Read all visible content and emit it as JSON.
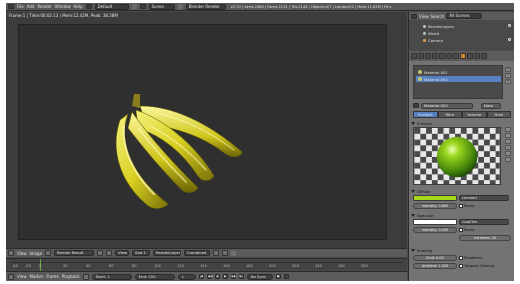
{
  "topbar": {
    "menus": [
      "File",
      "Add",
      "Render",
      "Window",
      "Help"
    ],
    "layout": "Default",
    "scene": "Scene",
    "engine": "Blender Render",
    "stats": "v2.70 | Verts:2080 | Faces:2112 | Tris:2144 | Objects:0/7 | Lamps:0/2 | Mem:11.61M | Pe:c"
  },
  "viewport": {
    "header": "Frame:1 | Time:00:02.13 | Mem:12.42M, Peak: 38.58M"
  },
  "image_header": {
    "items": [
      "View",
      "Image"
    ],
    "image_name": "Render Result",
    "view_label": "View",
    "slot": "Slot 1",
    "layer": "RenderLayer",
    "pass": "Combined"
  },
  "timeline": {
    "ticks": [
      "-40",
      "-20",
      "0",
      "20",
      "40",
      "60",
      "80",
      "100",
      "120",
      "140",
      "160",
      "180",
      "200",
      "220",
      "240",
      "260",
      "280"
    ]
  },
  "timeline_header": {
    "items": [
      "View",
      "Marker",
      "Frame",
      "Playback"
    ],
    "start": "Start: 1",
    "end": "End: 250",
    "current": "1",
    "sync": "No Sync"
  },
  "outliner": {
    "menu": "View",
    "search_label": "Search",
    "filter": "All Scenes",
    "items": [
      "RenderLayers",
      "World",
      "Camera"
    ]
  },
  "properties": {
    "materials": [
      "Material.001",
      "Material.002"
    ],
    "material_name": "Material.002",
    "data_label": "Data",
    "tabs": [
      "Surface",
      "Wire",
      "Volume",
      "Halo"
    ],
    "preview_label": "Preview",
    "diffuse": {
      "label": "Diffuse",
      "color": "#a6d619",
      "shader": "Lambert",
      "intensity": "Intensity: 0.800",
      "ramp_label": "Ramp"
    },
    "specular": {
      "label": "Specular",
      "color": "#ffffff",
      "shader": "CookTorr",
      "intensity": "Intensity: 0.500",
      "ramp_label": "Ramp",
      "hardness": "Hardness: 50"
    },
    "shading": {
      "label": "Shading",
      "emit": "Emit: 0.00",
      "shadeless": "Shadeless",
      "ambient": "Ambient: 1.000",
      "tangent": "Tangent Shading"
    }
  }
}
